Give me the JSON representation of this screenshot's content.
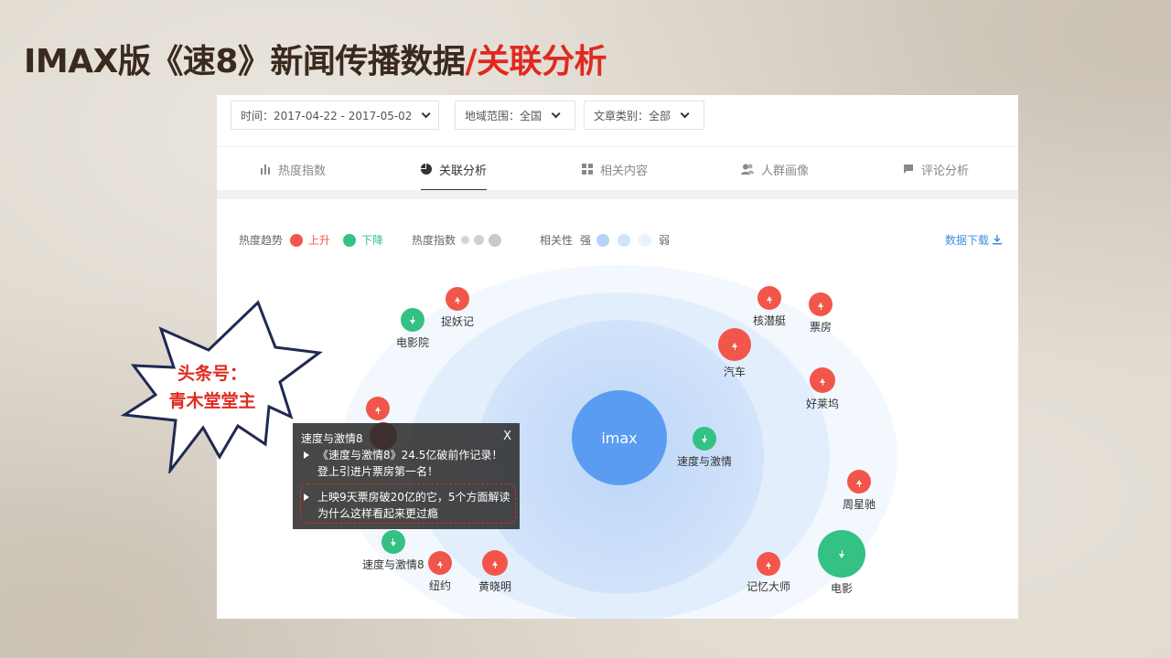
{
  "title": {
    "main": "IMAX版《速8》新闻传播数据",
    "accent": "/关联分析"
  },
  "filters": {
    "time": "时间：2017-04-22 - 2017-05-02",
    "region": "地域范围：全国",
    "category": "文章类别：全部"
  },
  "tabs": [
    {
      "label": "热度指数",
      "icon": "bar-chart-icon"
    },
    {
      "label": "关联分析",
      "icon": "pie-chart-icon",
      "active": true
    },
    {
      "label": "相关内容",
      "icon": "grid-icon"
    },
    {
      "label": "人群画像",
      "icon": "users-icon"
    },
    {
      "label": "评论分析",
      "icon": "comment-icon"
    }
  ],
  "legend": {
    "trend_label": "热度趋势",
    "up": "上升",
    "down": "下降",
    "heat_label": "热度指数",
    "relevance_label": "相关性",
    "strong": "强",
    "weak": "弱",
    "download": "数据下载"
  },
  "colors": {
    "up": "#f2564a",
    "down": "#34c184",
    "center": "#5a9cf1",
    "link": "#3d8ee0",
    "title_accent": "#e0291f"
  },
  "graph": {
    "center": "imax",
    "nodes": [
      {
        "label": "捉妖记",
        "trend": "up"
      },
      {
        "label": "电影院",
        "trend": "down"
      },
      {
        "label": "核潜艇",
        "trend": "up"
      },
      {
        "label": "票房",
        "trend": "up"
      },
      {
        "label": "汽车",
        "trend": "up"
      },
      {
        "label": "好莱坞",
        "trend": "up"
      },
      {
        "label": "速度与激情",
        "trend": "down"
      },
      {
        "label": "周星驰",
        "trend": "up"
      },
      {
        "label": "速度与激情8",
        "trend": "down"
      },
      {
        "label": "纽约",
        "trend": "up"
      },
      {
        "label": "黄晓明",
        "trend": "up"
      },
      {
        "label": "记忆大师",
        "trend": "up"
      },
      {
        "label": "电影",
        "trend": "down"
      }
    ]
  },
  "tooltip": {
    "title": "速度与激情8",
    "close": "X",
    "items": [
      "《速度与激情8》24.5亿破前作记录！登上引进片票房第一名！",
      "上映9天票房破20亿的它，5个方面解读为什么这样看起来更过瘾"
    ]
  },
  "callout": {
    "line1": "头条号：",
    "line2": "青木堂堂主"
  }
}
